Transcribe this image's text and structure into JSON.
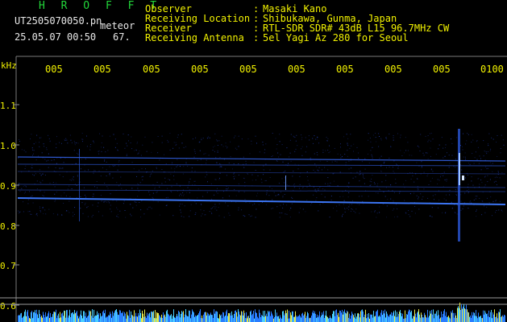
{
  "header": {
    "title": "H R O F F T",
    "filename": "UT2505070050.pn",
    "mode": "meteor",
    "datetime": "25.05.07 00:50",
    "counter": "67.",
    "fields": [
      {
        "label": "Observer",
        "value": "Masaki Kano"
      },
      {
        "label": "Receiving Location",
        "value": "Shibukawa, Gunma, Japan"
      },
      {
        "label": "Receiver",
        "value": "RTL-SDR SDR# 43dB L15 96.7MHz CW"
      },
      {
        "label": "Receiving Antenna",
        "value": "5el Yagi Az 280 for Seoul"
      }
    ],
    "separator": ":"
  },
  "axes": {
    "y_unit": "kHz",
    "y_ticks": [
      "1.1",
      "1.0",
      "0.9",
      "0.8",
      "0.7",
      "0.6"
    ],
    "x_ticks": [
      "005",
      "005",
      "005",
      "005",
      "005",
      "005",
      "005",
      "005",
      "005",
      "0100"
    ]
  },
  "colors": {
    "background": "#000000",
    "text_yellow": "#f2f200",
    "title_green": "#22d63a",
    "signal_blue": "#2f6bff",
    "noise_floor": "#3aa0ff"
  }
}
